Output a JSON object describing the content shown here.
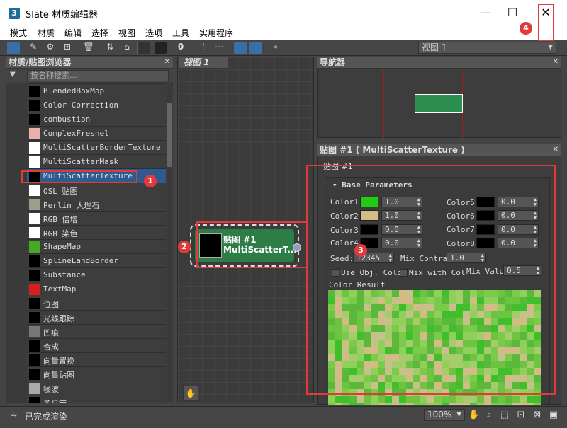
{
  "window": {
    "title": "Slate 材质编辑器",
    "app_icon": "3"
  },
  "menu": [
    "模式",
    "材质",
    "编辑",
    "选择",
    "视图",
    "选项",
    "工具",
    "实用程序"
  ],
  "view_selector": "视图 1",
  "browser": {
    "title": "材质/贴图浏览器",
    "search_placeholder": "按名称搜索...",
    "items": [
      {
        "label": "BlendedBoxMap",
        "swatch": "#000000"
      },
      {
        "label": "Color Correction",
        "swatch": "#000000"
      },
      {
        "label": "combustion",
        "swatch": "#000000"
      },
      {
        "label": "ComplexFresnel",
        "swatch": "#e8b0a8"
      },
      {
        "label": "MultiScatterBorderTexture",
        "swatch": "#ffffff"
      },
      {
        "label": "MultiScatterMask",
        "swatch": "#ffffff"
      },
      {
        "label": "MultiScatterTexture",
        "swatch": "#000000"
      },
      {
        "label": "OSL 贴图",
        "swatch": "#ffffff"
      },
      {
        "label": "Perlin 大理石",
        "swatch": "#9aa08a"
      },
      {
        "label": "RGB 倍增",
        "swatch": "#ffffff"
      },
      {
        "label": "RGB 染色",
        "swatch": "#ffffff"
      },
      {
        "label": "ShapeMap",
        "swatch": "#44aa22"
      },
      {
        "label": "SplineLandBorder",
        "swatch": "#000000"
      },
      {
        "label": "Substance",
        "swatch": "#000000"
      },
      {
        "label": "TextMap",
        "swatch": "#d81e1e"
      },
      {
        "label": "位图",
        "swatch": "#000000"
      },
      {
        "label": "光线跟踪",
        "swatch": "#000000"
      },
      {
        "label": "凹痕",
        "swatch": "#777777"
      },
      {
        "label": "合成",
        "swatch": "#000000"
      },
      {
        "label": "向量置换",
        "swatch": "#000000"
      },
      {
        "label": "向量贴图",
        "swatch": "#000000"
      },
      {
        "label": "噪波",
        "swatch": "#aaaaaa"
      },
      {
        "label": "多平铺",
        "swatch": "#000000"
      }
    ],
    "selected_index": 6
  },
  "view": {
    "tab": "视图 1",
    "node": {
      "title": "贴图 #1",
      "subtitle": "MultiScatterT..."
    }
  },
  "navigator": {
    "title": "导航器"
  },
  "properties": {
    "title": "贴图 #1 ( MultiScatterTexture )",
    "subtitle": "贴图 #1",
    "rollout": "Base Parameters",
    "colors_left": [
      {
        "label": "Color1",
        "swatch": "#22cc11",
        "value": "1.0"
      },
      {
        "label": "Color2",
        "swatch": "#d6bb83",
        "value": "1.0"
      },
      {
        "label": "Color3",
        "swatch": "#000000",
        "value": "0.0"
      },
      {
        "label": "Color4",
        "swatch": "#000000",
        "value": "0.0"
      }
    ],
    "colors_right": [
      {
        "label": "Color5",
        "swatch": "#000000",
        "value": "0.0"
      },
      {
        "label": "Color6",
        "swatch": "#000000",
        "value": "0.0"
      },
      {
        "label": "Color7",
        "swatch": "#000000",
        "value": "0.0"
      },
      {
        "label": "Color8",
        "swatch": "#000000",
        "value": "0.0"
      }
    ],
    "seed_label": "Seed:",
    "seed_value": "12345",
    "mix_contrast_label": "Mix Contras",
    "mix_contrast_value": "1.0",
    "use_obj_label": "Use Obj. Colo",
    "mix_with_label": "Mix with Col",
    "mix_value_label": "Mix Valu",
    "mix_value": "0.5",
    "color_result_label": "Color Result"
  },
  "status": {
    "text": "已完成渲染",
    "zoom": "100%"
  },
  "annotations": [
    "1",
    "2",
    "3",
    "4"
  ],
  "colors": {
    "accent_red": "#e03a3a",
    "selected": "#2d5b8f",
    "node_green": "#2d7d46"
  }
}
